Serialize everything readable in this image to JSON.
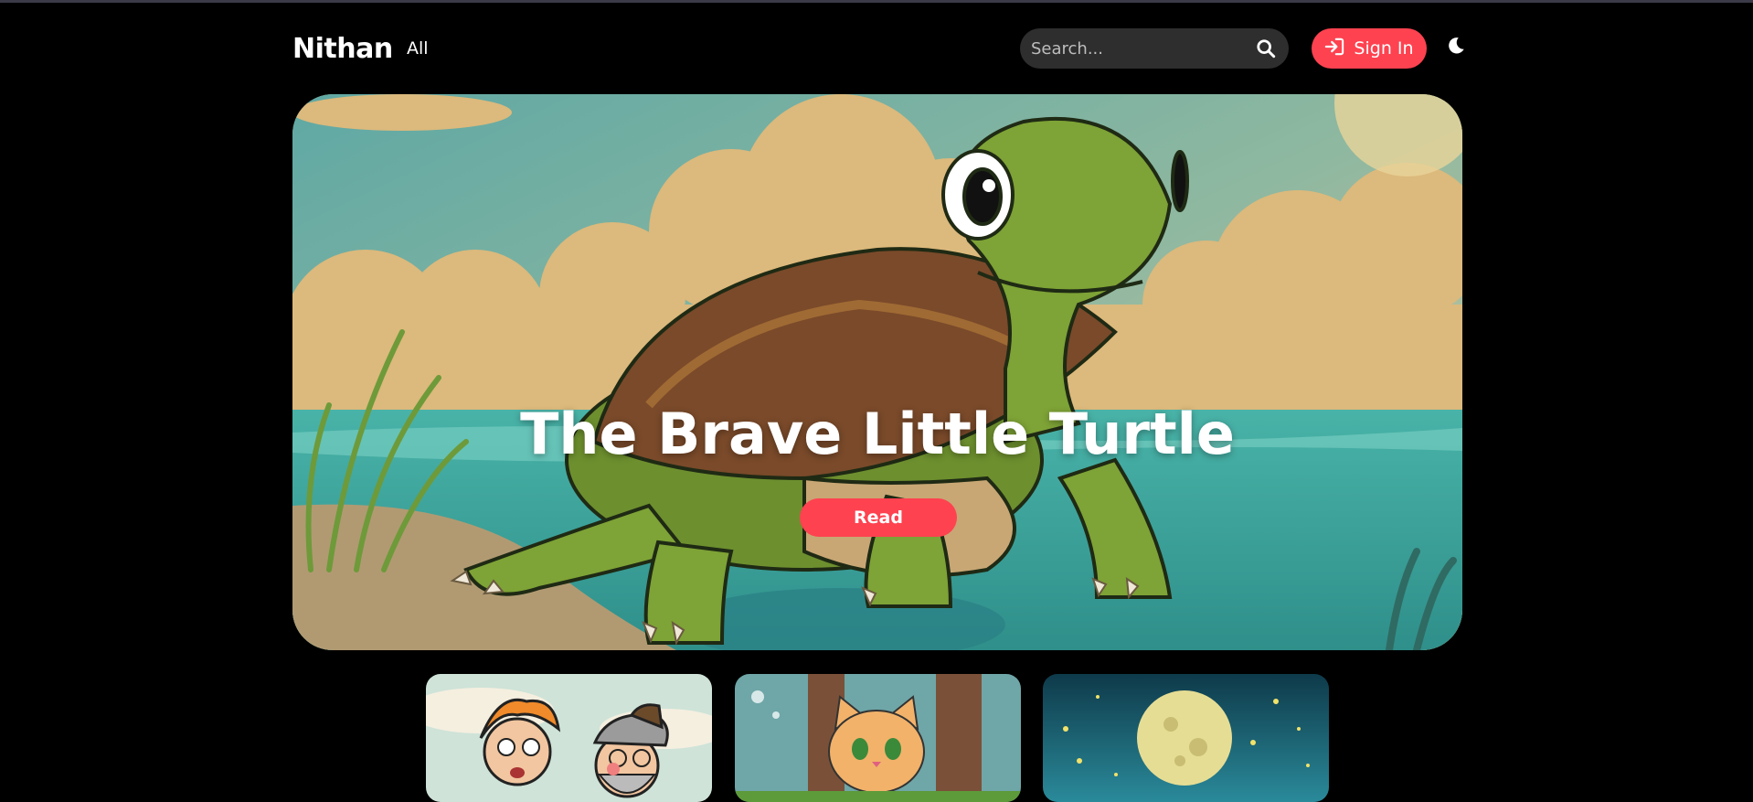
{
  "nav": {
    "brand": "Nithan",
    "all_link": "All",
    "search_placeholder": "Search...",
    "signin_label": "Sign In"
  },
  "hero": {
    "title": "The Brave Little Turtle",
    "read_label": "Read"
  },
  "icons": {
    "search": "search-icon",
    "signin": "sign-in-icon",
    "theme": "moon-icon"
  },
  "colors": {
    "accent": "#fe4250",
    "background": "#000000",
    "search_bg": "#2e2e2e"
  }
}
